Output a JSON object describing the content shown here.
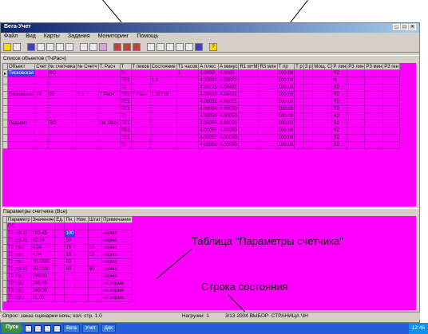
{
  "window": {
    "title": "Вега-Учет",
    "menu": [
      "Файл",
      "Вид",
      "Карты",
      "Задания",
      "Мониторинг",
      "Помощь"
    ]
  },
  "toolbar": {
    "icons": [
      "exit-icon",
      "print-icon",
      "open-icon",
      "save-icon",
      "object-icon",
      "meter-icon",
      "link-icon",
      "find-icon",
      "zoom-icon",
      "graph-icon",
      "table-icon",
      "grid-icon",
      "report-icon",
      "calendar-icon",
      "add-icon",
      "delete-icon",
      "refresh-icon",
      "info-icon",
      "help-icon"
    ]
  },
  "objects_panel": {
    "title": "Список объектов (ТчРасч)",
    "columns": [
      "Объект",
      "Счет",
      "№ счетчика",
      "№ Счетч",
      "Т. Расч",
      "Т",
      "Т пиков",
      "Состояние",
      "Т1 часов",
      "А плюс",
      "А минус",
      "R1 м+M",
      "R3 млн",
      "Т пр",
      "Т р",
      "З р",
      "Мощ. С",
      "Р лин",
      "P3 лин",
      "P3 мин",
      "P3 ген"
    ],
    "rows": [
      [
        "Тисковская",
        "",
        "RO",
        "",
        "",
        "",
        "",
        "",
        "1",
        "",
        "",
        "",
        "",
        "",
        "",
        "",
        "",
        "",
        "",
        "",
        ""
      ],
      [
        "",
        "",
        "",
        "",
        "",
        "",
        "",
        "",
        "",
        "",
        "",
        "",
        "",
        "",
        "",
        "",
        "",
        "",
        "",
        "",
        ""
      ],
      [
        "",
        "",
        "",
        "",
        "",
        "",
        "",
        "",
        "",
        "",
        "",
        "",
        "",
        "",
        "",
        "",
        "",
        "",
        "",
        "",
        ""
      ],
      [
        "Тисковская",
        "74",
        "95",
        "5.1",
        "Т Расч",
        "",
        "Т Расч",
        "",
        "",
        "",
        "",
        "",
        "",
        "",
        "",
        "",
        "",
        "",
        "",
        "",
        ""
      ],
      [
        "",
        "",
        "",
        "",
        "",
        "",
        "",
        "",
        "",
        "",
        "",
        "",
        "",
        "",
        "",
        "",
        "",
        "",
        "",
        "",
        ""
      ],
      [
        "",
        "",
        "",
        "",
        "",
        "",
        "",
        "",
        "",
        "",
        "",
        "",
        "",
        "",
        "",
        "",
        "",
        "",
        "",
        "",
        ""
      ],
      [
        "",
        "",
        "",
        "",
        "",
        "",
        "",
        "",
        "",
        "",
        "",
        "",
        "",
        "",
        "",
        "",
        "",
        "",
        "",
        "",
        ""
      ],
      [
        "Ледевит",
        "",
        "RO",
        "",
        "Ок. Расч",
        "",
        "",
        "",
        "",
        "",
        "",
        "",
        "",
        "",
        "",
        "",
        "",
        "",
        "",
        "",
        ""
      ],
      [
        "",
        "",
        "",
        "",
        "",
        "",
        "",
        "",
        "",
        "",
        "",
        "",
        "",
        "",
        "",
        "",
        "",
        "",
        "",
        "",
        ""
      ],
      [
        "",
        "",
        "",
        "",
        "",
        "",
        "",
        "",
        "",
        "",
        "",
        "",
        "",
        "",
        "",
        "",
        "",
        "",
        "",
        "",
        ""
      ],
      [
        "",
        "",
        "",
        "",
        "",
        "",
        "",
        "",
        "",
        "",
        "",
        "",
        "",
        "",
        "",
        "",
        "",
        "",
        "",
        "",
        ""
      ]
    ],
    "t_values": [
      "То",
      "ТЕ1",
      "Т2",
      "ТЕ2",
      "ТЕ1",
      "ТЕ1",
      "То",
      "ТЕ1",
      "ТЕ2",
      "ТЕ1",
      "То"
    ],
    "state_values": [
      "",
      "1.1",
      "",
      "1.20728",
      "",
      "",
      "",
      "",
      "",
      "",
      ""
    ],
    "a_plus": [
      "4.0050",
      "4.35850",
      "4.08721",
      "4.08420",
      "4.06051",
      "4.00050",
      "4.00050",
      "4.00050",
      "4.00050",
      "4.00050",
      "4.00050"
    ],
    "a_minus": [
      "4.0060",
      "4.29662",
      "4.08491",
      "4.08421",
      "4.06051",
      "4.00050",
      "4.00050",
      "4.00050",
      "4.00050",
      "4.00050",
      "4.00050"
    ],
    "tp_values": [
      "100.08",
      "100.00",
      "100.00",
      "100.00",
      "100.00",
      "100.00",
      "100.00",
      "100.00",
      "100.00",
      "100.00",
      "100.00"
    ],
    "pl_values": [
      "R2",
      "N",
      "R2",
      "R2",
      "R2",
      "R2",
      "R2",
      "R2",
      "R2",
      "R2",
      "R2"
    ]
  },
  "params_panel": {
    "title": "Параметры счетчика (Все)",
    "columns": [
      "Параметр",
      "Значение",
      "Ед.",
      "Пн.",
      "Ном.",
      "Штат",
      "Примечание"
    ],
    "rows": [
      [
        "ПС",
        "",
        "",
        "",
        "",
        "",
        ""
      ],
      [
        "Т1 (тр.1)",
        "102.45",
        "",
        "100",
        "",
        "",
        "норма"
      ],
      [
        "Т1 (тр.2)",
        "62.04",
        "",
        "50",
        "",
        "",
        "норма"
      ],
      [
        "Т2 (тр.)",
        "4.04",
        "",
        "16",
        "",
        "16",
        "норма"
      ],
      [
        "Т2 (тр.)",
        "4.04",
        "",
        "16",
        "",
        "16",
        "норма"
      ],
      [
        "Т1 (тр.)",
        "50.0000",
        "",
        "50",
        "",
        "",
        "норма"
      ],
      [
        "Т2 (тр.2)",
        "50.0100",
        "",
        "50",
        "",
        "60",
        "норма"
      ],
      [
        "Т2 (тр.)",
        "220.00",
        "",
        "",
        "",
        "",
        "норма"
      ],
      [
        "Т2 (тр.)",
        "240.00",
        "",
        "",
        "",
        "",
        "не норма"
      ],
      [
        "Т3 (тр.)",
        "240.00",
        "",
        "",
        "",
        "",
        "не норма"
      ],
      [
        "Т1 (тр.)",
        "11.00",
        "",
        "",
        "",
        "",
        "не норма"
      ]
    ]
  },
  "callouts": {
    "table_label": "Таблица \"Параметры счетчика\"",
    "status_label": "Строка состояния"
  },
  "statusbar": {
    "left": "Опрос: заказ сценарии ночь; кол. стр. 1.0",
    "middle": "Нагрузки: 1",
    "right": "3/13 2004 ВЫБОР: СТРАНИЦА ЧН"
  },
  "taskbar": {
    "start": "Пуск",
    "buttons": [
      "Вега",
      "Учет",
      "Док"
    ],
    "clock": "12:46"
  },
  "colors": {
    "grid_bg": "#ff00ff",
    "selection": "#3a3aff",
    "chrome": "#d4d0c8",
    "taskbar": "#245edb"
  }
}
